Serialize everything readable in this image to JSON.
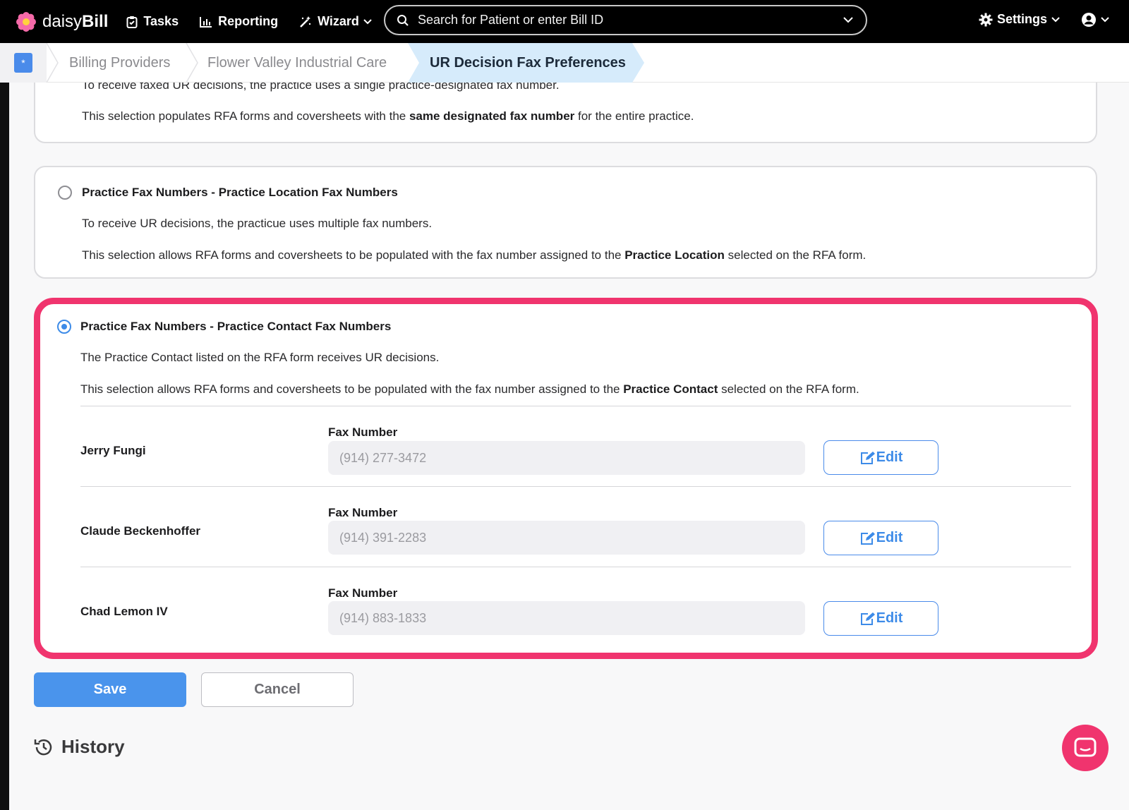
{
  "topbar": {
    "brand_light": "daisy",
    "brand_bold": "Bill",
    "tasks": "Tasks",
    "reporting": "Reporting",
    "wizard": "Wizard",
    "search_text": "Search for Patient or enter Bill ID",
    "settings": "Settings"
  },
  "breadcrumb": {
    "items": [
      "Billing Providers",
      "Flower Valley Industrial Care",
      "UR Decision Fax Preferences"
    ]
  },
  "options": [
    {
      "title": "",
      "line1": "To receive faxed UR decisions, the practice uses a single practice-designated fax number.",
      "line2_pre": "This selection populates RFA forms and coversheets with the ",
      "line2_bold": "same designated fax number",
      "line2_post": " for the entire practice.",
      "selected": false
    },
    {
      "title": "Practice Fax Numbers - Practice Location Fax Numbers",
      "line1": "To receive UR decisions, the practicue uses multiple fax numbers.",
      "line2_pre": "This selection allows RFA forms and coversheets to be populated with the fax number assigned to the ",
      "line2_bold": "Practice Location",
      "line2_post": " selected on the RFA form.",
      "selected": false
    },
    {
      "title": "Practice Fax Numbers - Practice Contact Fax Numbers",
      "line1": "The Practice Contact listed on the RFA form receives UR decisions.",
      "line2_pre": "This selection allows RFA forms and coversheets to be populated with the fax number assigned to the ",
      "line2_bold": "Practice Contact",
      "line2_post": " selected on the RFA form.",
      "selected": true
    }
  ],
  "contacts": [
    {
      "name": "Jerry Fungi",
      "fax_label": "Fax Number",
      "fax": "(914) 277-3472",
      "edit": "Edit"
    },
    {
      "name": "Claude Beckenhoffer",
      "fax_label": "Fax Number",
      "fax": "(914) 391-2283",
      "edit": "Edit"
    },
    {
      "name": "Chad Lemon IV",
      "fax_label": "Fax Number",
      "fax": "(914) 883-1833",
      "edit": "Edit"
    }
  ],
  "actions": {
    "save": "Save",
    "cancel": "Cancel"
  },
  "history": {
    "title": "History"
  },
  "colors": {
    "accent": "#4a94ec",
    "highlight": "#f0346e",
    "topbar": "#000000",
    "crumb_active": "#d6ebfb"
  }
}
